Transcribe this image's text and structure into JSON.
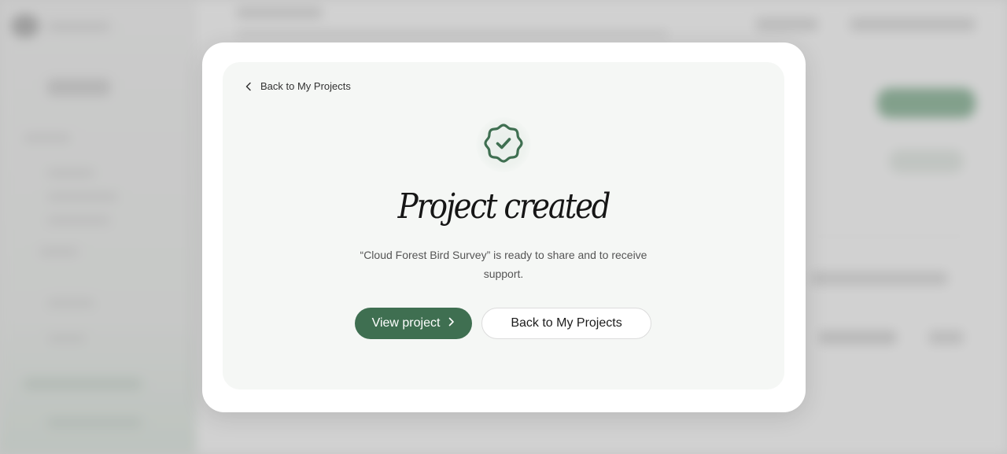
{
  "modal": {
    "back_link_label": "Back to My Projects",
    "title": "Project created",
    "description": "“Cloud Forest Bird Survey” is ready to share and to receive support.",
    "primary_button_label": "View project",
    "secondary_button_label": "Back to My Projects"
  },
  "icons": {
    "back": "chevron-left-icon",
    "badge": "verified-badge-icon",
    "primary_arrow": "chevron-right-icon"
  },
  "colors": {
    "accent": "#3f6f51",
    "card_background": "#f5f7f5",
    "modal_background": "#ffffff"
  }
}
